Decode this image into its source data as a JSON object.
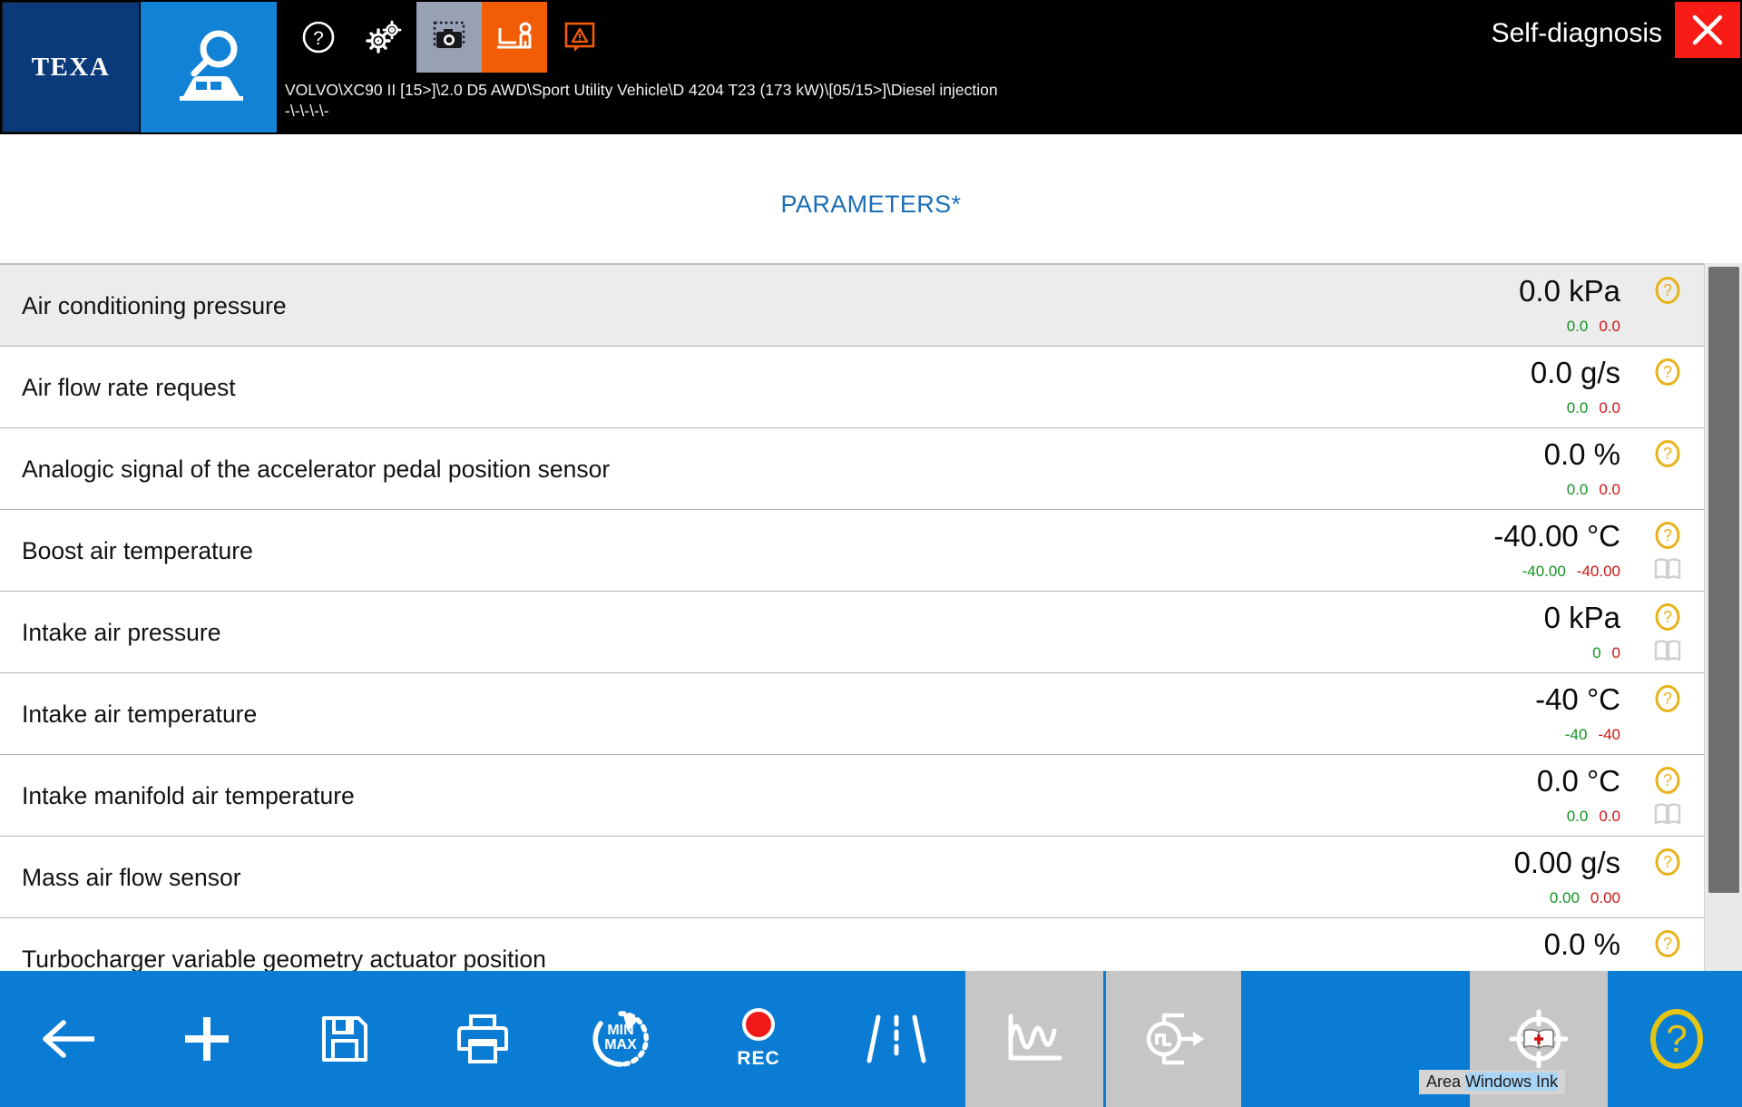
{
  "header": {
    "brand": "TEXA",
    "mode_title": "Self-diagnosis",
    "breadcrumb": "VOLVO\\XC90 II [15>]\\2.0 D5 AWD\\Sport Utility Vehicle\\D 4204 T23 (173 kW)\\[05/15>]\\Diesel injection\n-\\-\\-\\-\\-",
    "icons": [
      {
        "name": "help-icon",
        "label": "Help"
      },
      {
        "name": "settings-gears-icon",
        "label": "Settings"
      },
      {
        "name": "screenshot-camera-icon",
        "label": "Screenshot"
      },
      {
        "name": "remote-support-icon",
        "label": "Remote support"
      },
      {
        "name": "warning-triangle-icon",
        "label": "Warnings"
      }
    ],
    "close_label": "Close"
  },
  "main": {
    "title": "PARAMETERS*"
  },
  "colors": {
    "accent_blue": "#0b7cd4",
    "title_blue": "#1b6eb5",
    "brand_navy": "#0a3a7a",
    "close_red": "#f91b16",
    "support_orange": "#f25c05",
    "min_green": "#119422",
    "max_red": "#d01414",
    "help_yellow": "#e8b21a",
    "toolbar_gray": "#c6c6c6"
  },
  "parameters": [
    {
      "label": "Air conditioning pressure",
      "value": "0.0 kPa",
      "min": "0.0",
      "max": "0.0",
      "has_book": false
    },
    {
      "label": "Air flow rate request",
      "value": "0.0 g/s",
      "min": "0.0",
      "max": "0.0",
      "has_book": false
    },
    {
      "label": "Analogic signal of the accelerator pedal position sensor",
      "value": "0.0 %",
      "min": "0.0",
      "max": "0.0",
      "has_book": false
    },
    {
      "label": "Boost air temperature",
      "value": "-40.00 °C",
      "min": "-40.00",
      "max": "-40.00",
      "has_book": true
    },
    {
      "label": "Intake air pressure",
      "value": "0 kPa",
      "min": "0",
      "max": "0",
      "has_book": true
    },
    {
      "label": "Intake air temperature",
      "value": "-40 °C",
      "min": "-40",
      "max": "-40",
      "has_book": false
    },
    {
      "label": "Intake manifold air temperature",
      "value": "0.0 °C",
      "min": "0.0",
      "max": "0.0",
      "has_book": true
    },
    {
      "label": "Mass air flow sensor",
      "value": "0.00 g/s",
      "min": "0.00",
      "max": "0.00",
      "has_book": false
    },
    {
      "label": "Turbocharger variable geometry actuator position",
      "value": "0.0 %",
      "min": "",
      "max": "",
      "has_book": false
    }
  ],
  "toolbar": {
    "buttons": [
      {
        "name": "back-button",
        "icon": "back-arrow-icon",
        "label": "Back",
        "style": "blue"
      },
      {
        "name": "add-parameter-button",
        "icon": "plus-icon",
        "label": "Add",
        "style": "blue"
      },
      {
        "name": "save-button",
        "icon": "floppy-save-icon",
        "label": "Save",
        "style": "blue"
      },
      {
        "name": "print-button",
        "icon": "printer-icon",
        "label": "Print",
        "style": "blue"
      },
      {
        "name": "reset-minmax-button",
        "icon": "minmax-reset-icon",
        "label": "MIN MAX",
        "style": "blue"
      },
      {
        "name": "record-button",
        "icon": "record-dot-icon",
        "label": "REC",
        "style": "blue"
      },
      {
        "name": "road-test-button",
        "icon": "road-lane-icon",
        "label": "Road test",
        "style": "blue"
      },
      {
        "name": "graph-button",
        "icon": "waveform-graph-icon",
        "label": "Graph",
        "style": "gray"
      },
      {
        "name": "signal-output-button",
        "icon": "signal-output-icon",
        "label": "Signal output",
        "style": "gray"
      },
      {
        "name": "empty-button",
        "icon": "",
        "label": "",
        "style": "blue"
      },
      {
        "name": "technical-data-button",
        "icon": "target-book-icon",
        "label": "Technical data",
        "style": "gray"
      },
      {
        "name": "help-button",
        "icon": "help-circle-icon",
        "label": "Help",
        "style": "blue"
      }
    ],
    "minmax_line1": "MIN",
    "minmax_line2": "MAX",
    "rec_label": "REC"
  },
  "tooltip": {
    "prefix": "Area ",
    "text": "Windows Ink"
  }
}
